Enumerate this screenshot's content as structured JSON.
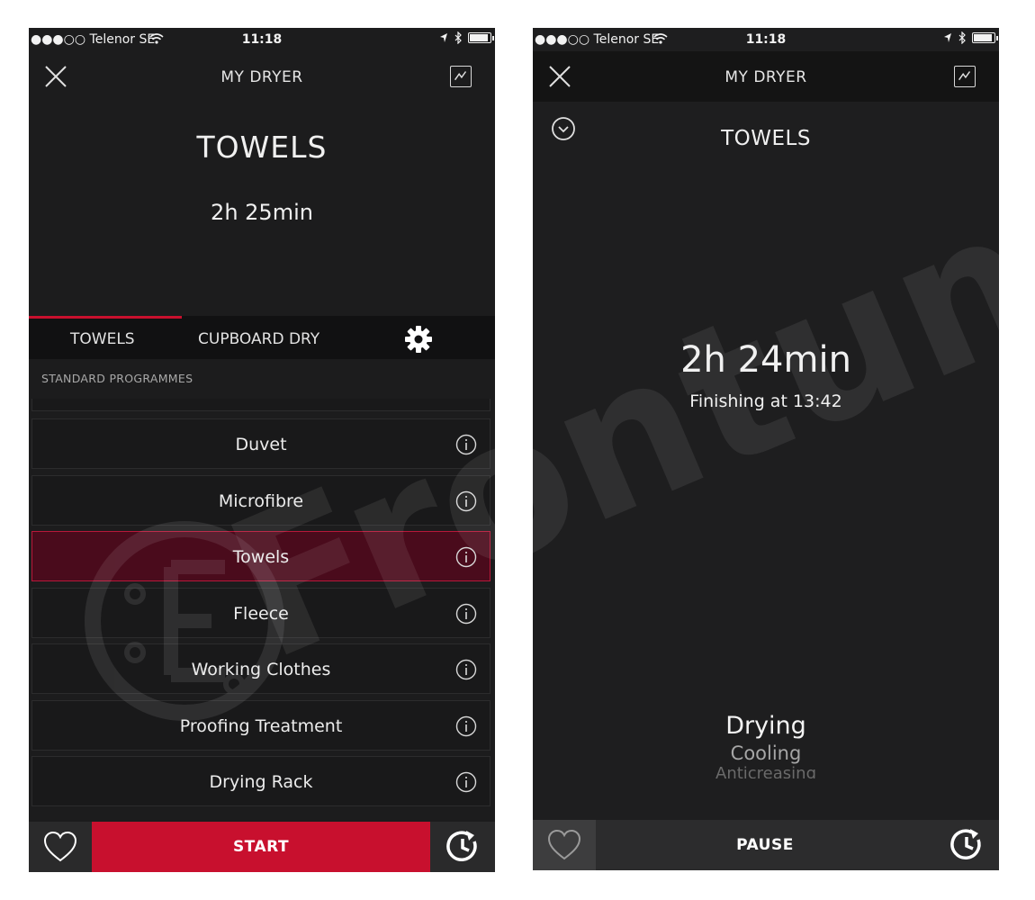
{
  "status_bar": {
    "carrier": "●●●○○ Telenor SE",
    "time": "11:18"
  },
  "left_screen": {
    "nav": {
      "title": "MY DRYER"
    },
    "programme_title": "TOWELS",
    "duration": "2h 25min",
    "tabs": [
      {
        "label": "TOWELS",
        "active": true
      },
      {
        "label": "CUPBOARD DRY",
        "active": false
      }
    ],
    "section_label": "STANDARD PROGRAMMES",
    "programmes": [
      {
        "label": "Duvet",
        "selected": false
      },
      {
        "label": "Microfibre",
        "selected": false
      },
      {
        "label": "Towels",
        "selected": true
      },
      {
        "label": "Fleece",
        "selected": false
      },
      {
        "label": "Working Clothes",
        "selected": false
      },
      {
        "label": "Proofing Treatment",
        "selected": false
      },
      {
        "label": "Drying Rack",
        "selected": false
      }
    ],
    "start_label": "START"
  },
  "right_screen": {
    "nav": {
      "title": "MY DRYER"
    },
    "programme_title": "TOWELS",
    "remaining": "2h 24min",
    "finishing": "Finishing at 13:42",
    "phases": {
      "active": "Drying",
      "next": "Cooling",
      "faded": "Anticreasing"
    },
    "pause_label": "PAUSE"
  },
  "watermark_text": "Frontum",
  "colors": {
    "accent": "#c8102e",
    "selected_row": "#4a0b1c",
    "background": "#1c1c1d",
    "text": "#ececec"
  },
  "icons": [
    "close-icon",
    "chart-icon",
    "gear-icon",
    "info-icon",
    "heart-icon",
    "timer-icon",
    "chevron-down-icon",
    "wifi-icon",
    "location-icon",
    "bluetooth-icon",
    "battery-icon"
  ]
}
